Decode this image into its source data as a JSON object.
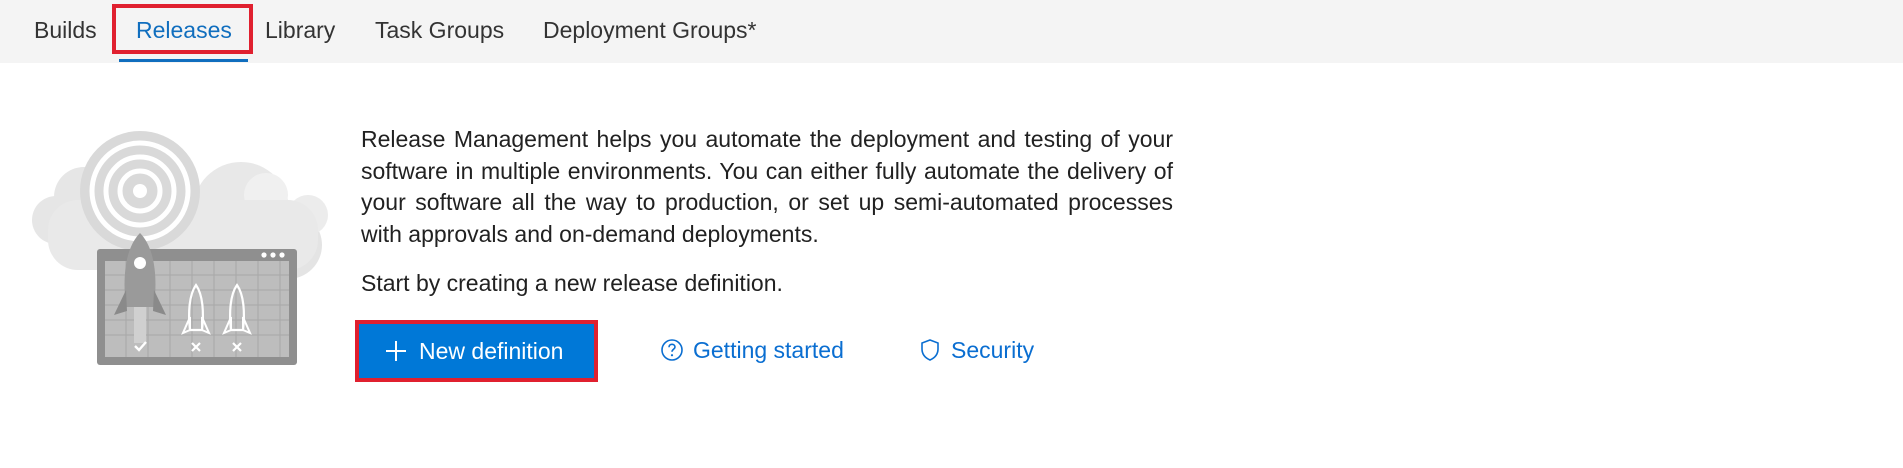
{
  "nav": {
    "tabs": [
      {
        "label": "Builds"
      },
      {
        "label": "Releases"
      },
      {
        "label": "Library"
      },
      {
        "label": "Task Groups"
      },
      {
        "label": "Deployment Groups*"
      }
    ],
    "active_tab": "Releases"
  },
  "main": {
    "illustration": "release-rocket-illustration",
    "description": "Release Management helps you automate the deployment and testing of your software in multiple environments. You can either fully automate the delivery of your software all the way to production, or set up semi-automated processes with approvals and on-demand deployments.",
    "start_text": "Start by creating a new release definition.",
    "new_definition_label": "New definition",
    "new_definition_icon": "plus-icon",
    "getting_started_label": "Getting started",
    "getting_started_icon": "help-circle-icon",
    "security_label": "Security",
    "security_icon": "shield-icon"
  },
  "colors": {
    "accent": "#0078d7",
    "link": "#0a6ed1",
    "active_tab": "#106ebe",
    "topbar_bg": "#f4f4f4",
    "highlight": "#e0202f"
  }
}
